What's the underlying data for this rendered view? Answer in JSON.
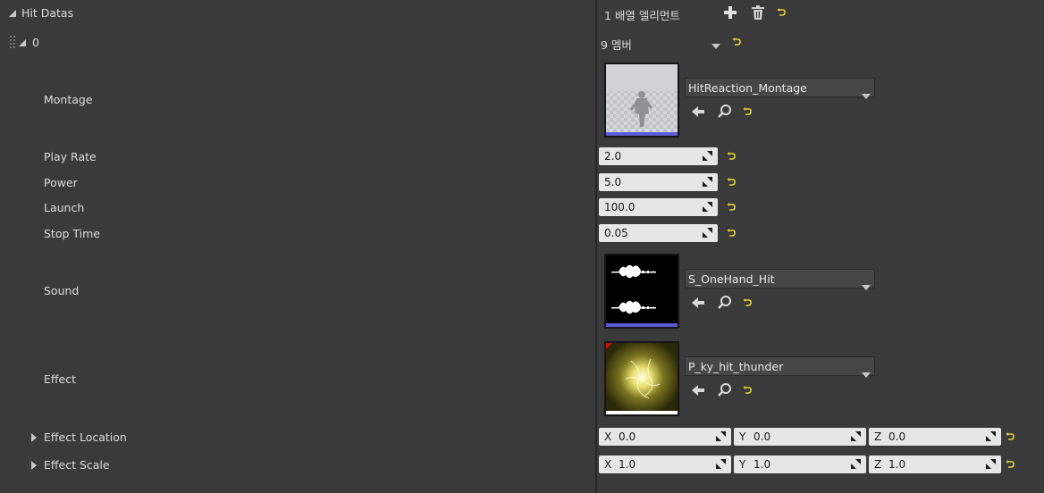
{
  "header": {
    "title": "Hit Datas",
    "array_count": "1 배열 엘리먼트"
  },
  "element": {
    "index": "0",
    "members": "9 멤버"
  },
  "fields": {
    "montage": {
      "label": "Montage",
      "asset": "HitReaction_Montage"
    },
    "play_rate": {
      "label": "Play Rate",
      "value": "2.0"
    },
    "power": {
      "label": "Power",
      "value": "5.0"
    },
    "launch": {
      "label": "Launch",
      "value": "100.0"
    },
    "stop_time": {
      "label": "Stop Time",
      "value": "0.05"
    },
    "sound": {
      "label": "Sound",
      "asset": "S_OneHand_Hit"
    },
    "effect": {
      "label": "Effect",
      "asset": "P_ky_hit_thunder"
    },
    "effect_location": {
      "label": "Effect Location",
      "x": "0.0",
      "y": "0.0",
      "z": "0.0"
    },
    "effect_scale": {
      "label": "Effect Scale",
      "x": "1.0",
      "y": "1.0",
      "z": "1.0"
    }
  },
  "axes": {
    "x": "X",
    "y": "Y",
    "z": "Z"
  },
  "colors": {
    "background": "#3a3a3a",
    "reset_arrow": "#e8d23a",
    "asset_underline_anim": "#5b5bd6",
    "asset_underline_sound": "#5b5bd6",
    "asset_underline_effect": "#ffffff"
  },
  "icons": [
    "collapse-triangle-icon",
    "plus-icon",
    "trash-icon",
    "reset-to-default-icon",
    "drag-handle-icon",
    "chevron-down-icon",
    "browse-arrow-icon",
    "search-icon",
    "drag-slider-icon",
    "expand-triangle-icon"
  ]
}
